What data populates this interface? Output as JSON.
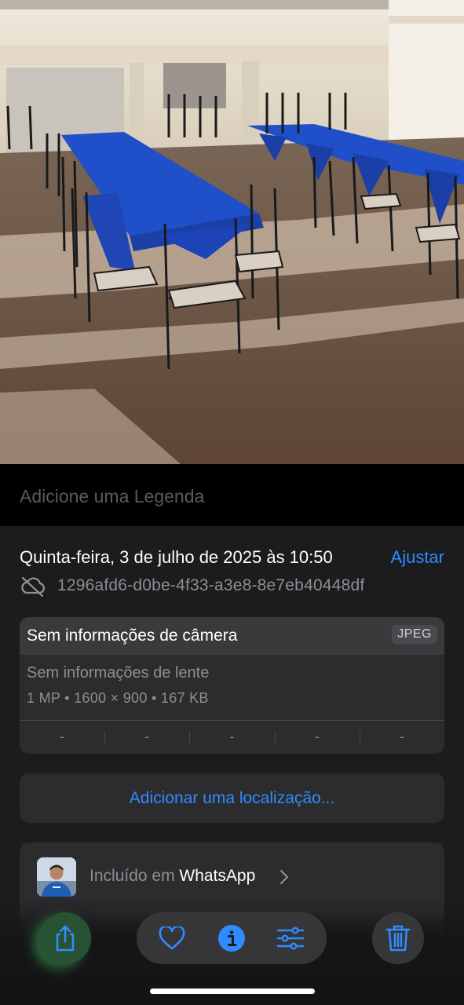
{
  "caption": {
    "placeholder": "Adicione uma Legenda"
  },
  "info": {
    "date": "Quinta-feira, 3 de julho de 2025 às 10:50",
    "adjust_label": "Ajustar",
    "filename": "1296afd6-d0be-4f33-a3e8-8e7eb40448df",
    "file_icon": "cloud-slash-icon"
  },
  "camera": {
    "title": "Sem informações de câmera",
    "format": "JPEG",
    "lens": "Sem informações de lente",
    "specs": "1 MP  •  1600 × 900  •  167 KB",
    "metrics": [
      "-",
      "-",
      "-",
      "-",
      "-"
    ]
  },
  "location": {
    "label": "Adicionar uma localização..."
  },
  "album": {
    "prefix": "Incluído em ",
    "name": "WhatsApp"
  },
  "toolbar": {
    "share_icon": "share-icon",
    "favorite_icon": "heart-icon",
    "info_icon": "info-icon",
    "edit_icon": "sliders-icon",
    "delete_icon": "trash-icon"
  },
  "colors": {
    "accent": "#2f8cff",
    "background": "#1c1c1e",
    "card": "#2c2c2e",
    "secondary_text": "#8e8e93"
  }
}
